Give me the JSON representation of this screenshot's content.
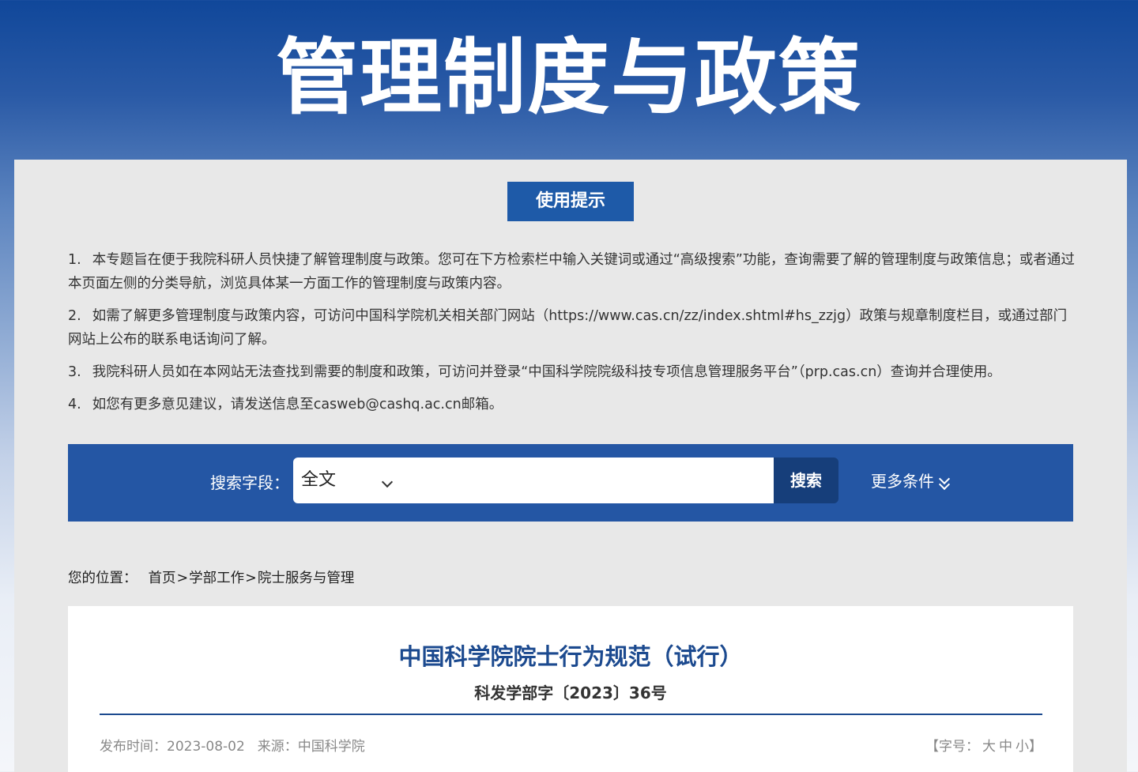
{
  "banner": {
    "title": "管理制度与政策"
  },
  "tips": {
    "button_label": "使用提示",
    "items": [
      {
        "num": "1.",
        "text": "本专题旨在便于我院科研人员快捷了解管理制度与政策。您可在下方检索栏中输入关键词或通过“高级搜索”功能，查询需要了解的管理制度与政策信息；或者通过本页面左侧的分类导航，浏览具体某一方面工作的管理制度与政策内容。"
      },
      {
        "num": "2.",
        "text": "如需了解更多管理制度与政策内容，可访问中国科学院机关相关部门网站（https://www.cas.cn/zz/index.shtml#hs_zzjg）政策与规章制度栏目，或通过部门网站上公布的联系电话询问了解。"
      },
      {
        "num": "3.",
        "text": "我院科研人员如在本网站无法查找到需要的制度和政策，可访问并登录“中国科学院院级科技专项信息管理服务平台”（prp.cas.cn）查询并合理使用。"
      },
      {
        "num": "4.",
        "text": "如您有更多意见建议，请发送信息至casweb@cashq.ac.cn邮箱。"
      }
    ]
  },
  "search": {
    "label": "搜索字段：",
    "field_selected": "全文",
    "input_value": "",
    "button_label": "搜索",
    "more_label": "更多条件"
  },
  "breadcrumb": {
    "lead": "您的位置：",
    "items": [
      "首页",
      "学部工作",
      "院士服务与管理"
    ],
    "separator": ">"
  },
  "article": {
    "title": "中国科学院院士行为规范（试行）",
    "doc_number": "科发学部字〔2023〕36号",
    "publish_label": "发布时间：",
    "publish_date": "2023-08-02",
    "source_label": "来源：",
    "source": "中国科学院",
    "font_size": {
      "open": "【",
      "label": "字号：",
      "large": "大",
      "medium": "中",
      "small": "小",
      "close": "】"
    }
  },
  "colors": {
    "brand_blue": "#1e5aa8",
    "search_bar": "#2456a4",
    "search_button": "#163e7a",
    "title_blue": "#1c4a8f"
  }
}
